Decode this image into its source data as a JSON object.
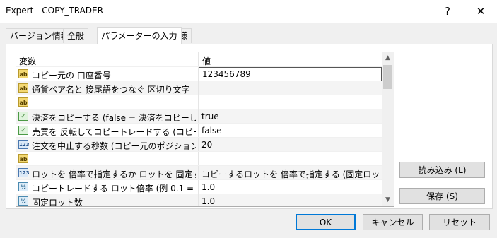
{
  "window": {
    "title": "Expert - COPY_TRADER",
    "help_glyph": "?",
    "close_glyph": "✕"
  },
  "tabs": [
    {
      "label": "バージョン情報",
      "active": false
    },
    {
      "label": "全般",
      "active": false
    },
    {
      "label": "パラメーターの入力",
      "active": true
    },
    {
      "label": "仕様",
      "active": false
    }
  ],
  "grid": {
    "headers": {
      "variable": "変数",
      "value": "値"
    },
    "rows": [
      {
        "icon": "ab",
        "name": "コピー元の 口座番号",
        "value": "123456789",
        "editing": true
      },
      {
        "icon": "ab",
        "name": "通貨ペア名と 接尾語をつなぐ 区切り文字 （･･",
        "value": ""
      },
      {
        "icon": "ab",
        "name": "",
        "value": ""
      },
      {
        "icon": "bool",
        "name": "決済をコピーする (false = 決済をコピーしないで･･",
        "value": "true"
      },
      {
        "icon": "bool",
        "name": "売買を 反転してコピートレードする (コピー元と 両･･",
        "value": "false"
      },
      {
        "icon": "int",
        "name": "注文を中止する秒数 (コピー元のポジションが約･･",
        "value": "20"
      },
      {
        "icon": "ab",
        "name": "",
        "value": ""
      },
      {
        "icon": "int",
        "name": "ロットを 倍率で指定するか ロットを 固定するか･･",
        "value": "コピーするロットを 倍率で指定する (固定ロット数は ･･"
      },
      {
        "icon": "dbl",
        "name": "コピートレードする ロット倍率 (例 0.1 = 1/10倍･･",
        "value": "1.0"
      },
      {
        "icon": "dbl",
        "name": "固定ロット数",
        "value": "1.0"
      }
    ],
    "icon_texts": {
      "ab": "ab",
      "bool": "✓",
      "int": "123",
      "dbl": "½"
    }
  },
  "side_buttons": {
    "load": "読み込み (L)",
    "save": "保存 (S)"
  },
  "bottom_buttons": {
    "ok": "OK",
    "cancel": "キャンセル",
    "reset": "リセット"
  }
}
